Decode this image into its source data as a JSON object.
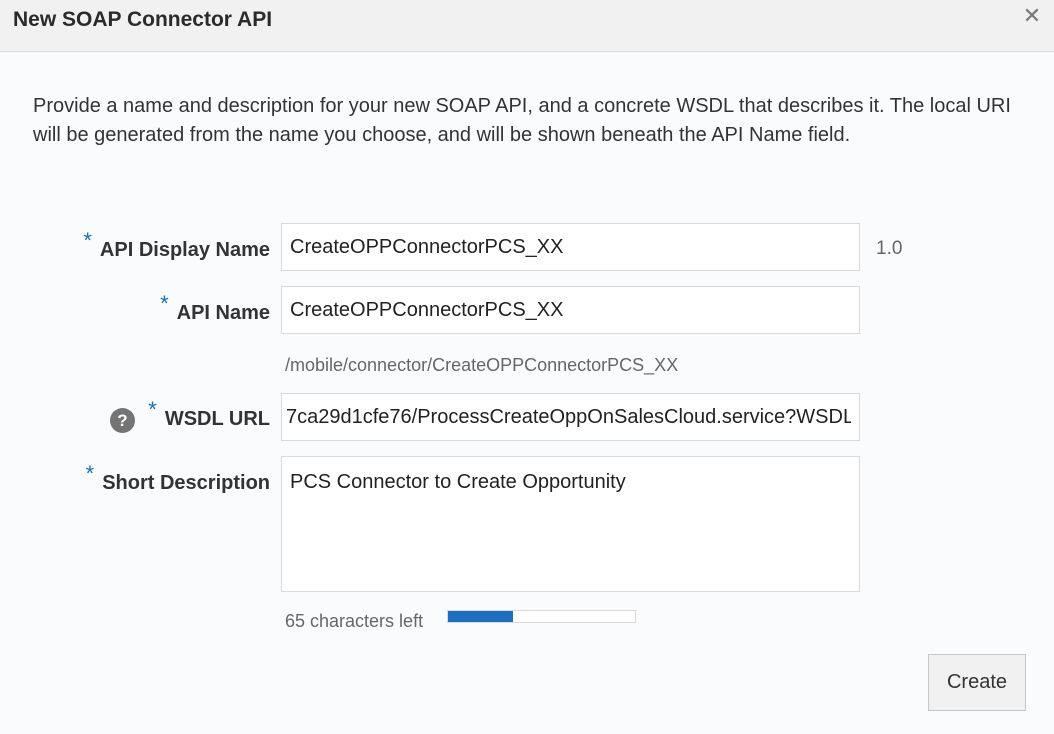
{
  "dialog": {
    "title": "New SOAP Connector API",
    "close_glyph": "✕",
    "intro": "Provide a name and description for your new SOAP API, and a concrete WSDL that describes it. The local URI will be generated from the name you choose, and will be shown beneath the API Name field."
  },
  "form": {
    "required_mark": "*",
    "api_display_name": {
      "label": "API Display Name",
      "value": "CreateOPPConnectorPCS_XX",
      "version": "1.0"
    },
    "api_name": {
      "label": "API Name",
      "value": "CreateOPPConnectorPCS_XX",
      "uri": "/mobile/connector/CreateOPPConnectorPCS_XX"
    },
    "wsdl_url": {
      "label": "WSDL URL",
      "value": "7ca29d1cfe76/ProcessCreateOppOnSalesCloud.service?WSDL",
      "help_glyph": "?"
    },
    "short_description": {
      "label": "Short Description",
      "value": "PCS Connector to Create Opportunity",
      "counter": "65 characters left",
      "used_fraction": 0.35
    }
  },
  "actions": {
    "create_label": "Create"
  },
  "colors": {
    "accent": "#1f6fc0",
    "required": "#1a6fb5",
    "header_bg": "#f1f1f1"
  }
}
